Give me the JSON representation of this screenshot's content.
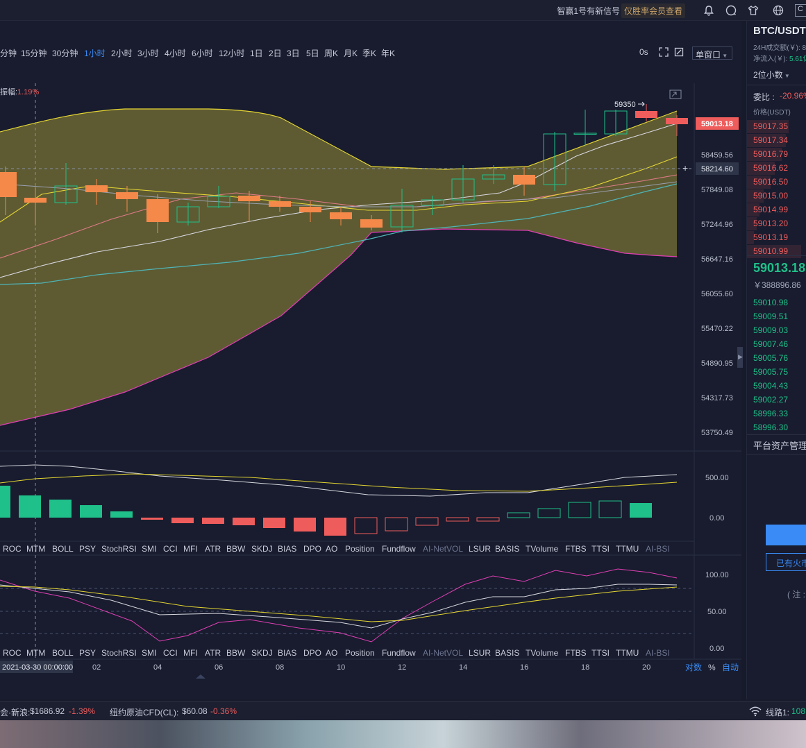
{
  "topbar": {
    "signal_text": "智赢1号有新信号",
    "vip_text": "仅胜率会员查看",
    "icons": [
      "bell-icon",
      "chat-icon",
      "shirt-icon",
      "globe-icon"
    ],
    "box_c": "C"
  },
  "toolbar": {
    "timeframes": [
      "分钟",
      "15分钟",
      "30分钟",
      "1小时",
      "2小时",
      "3小时",
      "4小时",
      "6小时",
      "12小时",
      "1日",
      "2日",
      "3日",
      "5日",
      "周K",
      "月K",
      "季K",
      "年K"
    ],
    "active_timeframe": "1小时",
    "countdown": "0s",
    "window_button": "单窗口"
  },
  "main_chart": {
    "amplitude_label": "振幅:",
    "amplitude_value": "1.19%",
    "high_marker": "59350",
    "price_axis": [
      "58459.56",
      "57849.08",
      "57244.96",
      "56647.16",
      "56055.60",
      "55470.22",
      "54890.95",
      "54317.73",
      "53750.49"
    ],
    "last_price_tag": "59013.18",
    "crosshair_price_tag": "58214.60"
  },
  "indicator1": {
    "axis": [
      "500.00",
      "0.00"
    ],
    "histogram": [
      230,
      160,
      130,
      90,
      45,
      -15,
      -40,
      -45,
      -55,
      -75,
      -100,
      -130,
      -115,
      -95,
      -55,
      -25,
      -25,
      35,
      65,
      110,
      120,
      105
    ]
  },
  "indicator_tabs": [
    "ROC",
    "MTM",
    "BOLL",
    "PSY",
    "StochRSI",
    "SMI",
    "CCI",
    "MFI",
    "ATR",
    "BBW",
    "SKDJ",
    "BIAS",
    "DPO",
    "AO",
    "Position",
    "Fundflow",
    "AI-NetVOL",
    "LSUR",
    "BASIS",
    "TVolume",
    "FTBS",
    "TTSI",
    "TTMU",
    "AI-BSI"
  ],
  "indicator2": {
    "axis": [
      "100.00",
      "50.00",
      "0.00"
    ]
  },
  "time_axis": {
    "cursor_label": "2021-03-30 00:00:00",
    "ticks": [
      "02",
      "04",
      "06",
      "08",
      "10",
      "12",
      "14",
      "16",
      "18",
      "20"
    ],
    "scale_options": [
      "对数",
      "%",
      "自动"
    ]
  },
  "right_panel": {
    "symbol": "BTC/USDT",
    "volume_label": "24H成交额(￥): 8",
    "inflow_label": "净流入(￥):",
    "inflow_value": "5.61亿",
    "precision": "2位小数",
    "ratio_label": "委比 :",
    "ratio_value": "-20.96%",
    "price_header": "价格(USDT)",
    "asks": [
      "59017.35",
      "59017.34",
      "59016.79",
      "59016.62",
      "59016.50",
      "59015.00",
      "59014.99",
      "59013.20",
      "59013.19",
      "59010.99"
    ],
    "last_price": "59013.18",
    "last_price_cny": "￥388896.86",
    "bids": [
      "59010.98",
      "59009.51",
      "59009.03",
      "59007.46",
      "59005.76",
      "59005.75",
      "59004.43",
      "59002.27",
      "58996.33",
      "58996.30"
    ],
    "asset_mgmt": "平台资产管理",
    "have_coin": "已有火币",
    "note": "( 注 :"
  },
  "bottom_bar": {
    "gold_label": "会·新浪:",
    "gold_value": "$1686.92",
    "gold_change": "-1.39%",
    "oil_label": "纽约原油CFD(CL):",
    "oil_value": "$60.08",
    "oil_change": "-0.36%",
    "line_label": "线路1:",
    "line_value": "108"
  },
  "colors": {
    "background": "#181c2e",
    "up": "#1fc089",
    "down": "#ef5c5c",
    "candle_down": "#f5894a",
    "band_fill": "#6b6634",
    "accent": "#3a8bf5"
  }
}
